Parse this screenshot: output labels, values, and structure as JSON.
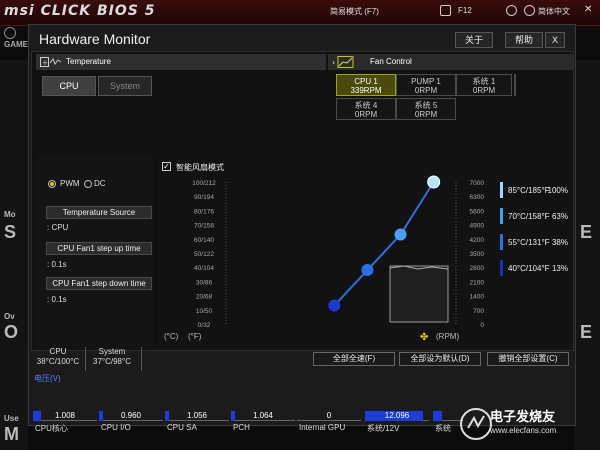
{
  "topbar": {
    "logo": "msi CLICK BIOS 5",
    "mode": "简易模式 (F7)",
    "f12": "F12",
    "language": "简体中文",
    "game": "GAME"
  },
  "background_fragments": {
    "left_1": "Mo",
    "left_2": "S",
    "left_3": "Ov",
    "left_4": "O",
    "left_5": "Use",
    "left_6": "M",
    "right_1": "E",
    "right_2": "E",
    "right_3": "",
    "right_4": ""
  },
  "window": {
    "title": "Hardware Monitor",
    "about": "关于",
    "help": "帮助",
    "close": "X"
  },
  "temperature": {
    "header": "Temperature",
    "tabs": [
      {
        "label": "CPU",
        "active": true
      },
      {
        "label": "System",
        "active": false
      }
    ]
  },
  "fan_control": {
    "header": "Fan Control",
    "fans": [
      {
        "name": "CPU 1",
        "rpm": "339RPM",
        "active": true
      },
      {
        "name": "PUMP 1",
        "rpm": "0RPM",
        "active": false
      },
      {
        "name": "系统 1",
        "rpm": "0RPM",
        "active": false
      },
      {
        "name": "系统 2",
        "rpm": "0RPM",
        "active": false
      },
      {
        "name": "系统 3",
        "rpm": "0RPM",
        "active": false
      },
      {
        "name": "系统 4",
        "rpm": "0RPM",
        "active": false
      },
      {
        "name": "系统 5",
        "rpm": "0RPM",
        "active": false
      }
    ]
  },
  "control_panel": {
    "pwm": "PWM",
    "dc": "DC",
    "mode_selected": "PWM",
    "temp_source_label": "Temperature Source",
    "temp_source_value": ": CPU",
    "step_up_label": "CPU Fan1 step up time",
    "step_up_value": ": 0.1s",
    "step_down_label": "CPU Fan1 step down time",
    "step_down_value": ": 0.1s"
  },
  "smart_fan": {
    "checkbox_label": "智能风扇模式",
    "checked": true,
    "temp_unit_c": "(°C)",
    "temp_unit_f": "(°F)",
    "rpm_unit": "(RPM)"
  },
  "chart_data": {
    "type": "line",
    "left_axis_labels": [
      "100/212",
      "90/194",
      "80/176",
      "70/158",
      "60/140",
      "50/122",
      "40/104",
      "30/86",
      "20/68",
      "10/50",
      "0/32"
    ],
    "right_axis_labels": [
      "7000",
      "6300",
      "5600",
      "4900",
      "4200",
      "3500",
      "2800",
      "2100",
      "1400",
      "700",
      "0"
    ],
    "ylim": [
      0,
      100
    ],
    "series": [
      {
        "x": [
          13,
          38,
          63,
          100
        ],
        "y": [
          40,
          40,
          38,
          13
        ]
      }
    ],
    "note_points": [
      {
        "temp": "40°C/104°F",
        "pct": "13%",
        "color": "#1b2fb8"
      },
      {
        "temp": "55°C/131°F",
        "pct": "38%",
        "color": "#2a6fe8"
      },
      {
        "temp": "70°C/158°F",
        "pct": "63%",
        "color": "#4aa0f0"
      },
      {
        "temp": "85°C/185°F",
        "pct": "100%",
        "color": "#9fd8ff"
      }
    ],
    "curve_points": [
      {
        "temp": 40,
        "pct": 13
      },
      {
        "temp": 55,
        "pct": 38
      },
      {
        "temp": 70,
        "pct": 63
      },
      {
        "temp": 85,
        "pct": 100
      }
    ]
  },
  "actions": {
    "full_speed": "全部全速(F)",
    "set_default": "全部设为默认(D)",
    "cancel_all": "撤销全部设置(C)"
  },
  "summary": {
    "cpu_label": "CPU",
    "cpu_value": "38°C/100°C",
    "system_label": "System",
    "system_value": "37°C/98°C"
  },
  "voltage": {
    "header": "电压(V)",
    "items": [
      {
        "label": "CPU核心",
        "value": "1.008",
        "level": 0.12
      },
      {
        "label": "CPU I/O",
        "value": "0.960",
        "level": 0.06
      },
      {
        "label": "CPU SA",
        "value": "1.056",
        "level": 0.06
      },
      {
        "label": "PCH",
        "value": "1.064",
        "level": 0.06
      },
      {
        "label": "Internal GPU",
        "value": "0",
        "level": 0.0
      },
      {
        "label": "系统/12V",
        "value": "12.096",
        "level": 0.9
      },
      {
        "label": "系统",
        "value": "",
        "level": 0.3
      }
    ]
  },
  "watermark": {
    "text": "电子发烧友",
    "url": "www.elecfans.com"
  }
}
